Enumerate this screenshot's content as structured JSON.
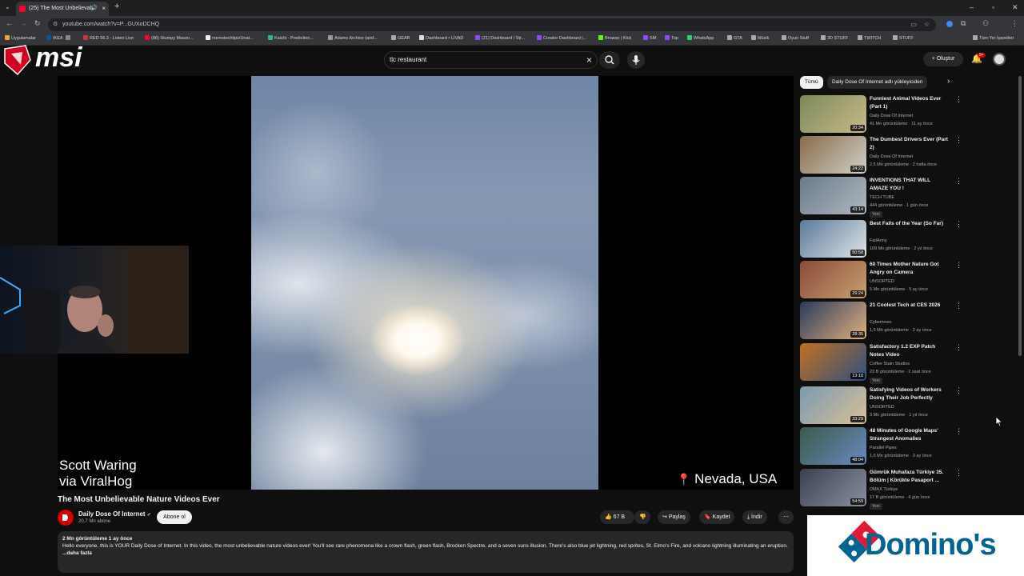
{
  "browser": {
    "tab_title": "(25) The Most Unbelievab",
    "url": "youtube.com/watch?v=P...GUXoDCHQ",
    "bookmarks": [
      "Uygulamalar",
      "IKEA",
      "RED 96.3 - Listen Live",
      "(88) Stumpy Mason...",
      "memstechtips/Unat...",
      "Kaishi - Prediction...",
      "Adams Archive (and...",
      "GEAR",
      "Dashboard • LIVAD",
      "(21) Dashboard / Str...",
      "Creator Dashboard |...",
      "Browse | Kick",
      "SM",
      "Top",
      "WhatsApp",
      "GTA",
      "Müzik",
      "Oyun Stuff",
      "3D STUFF",
      "TWITCH",
      "STUFF"
    ],
    "bookmarks_right": "Tüm Yer İşaretleri"
  },
  "header": {
    "logo_text": "msi",
    "search_value": "tlc restaurant",
    "create_label": "Oluştur",
    "notif_count": "9+"
  },
  "video": {
    "caption_left_1": "Scott Waring",
    "caption_left_2": "via ViralHog",
    "location": "Nevada, USA"
  },
  "info": {
    "title": "The Most Unbelievable Nature Videos Ever",
    "channel": "Daily Dose Of Internet",
    "subscribers": "20,7 Mn abone",
    "subscribe_label": "Abone ol",
    "likes": "67 B",
    "share_label": "Paylaş",
    "save_label": "Kaydet",
    "download_label": "İndir",
    "views_date": "2 Mn görüntüleme  1 ay önce",
    "description": "Hello everyone, this is YOUR Daily Dose of Internet. In this video, the most unbelievable nature videos ever! You'll see rare phenomena like a crown flash, green flash, Brocken Spectre, and a seven suns illusion. There's also blue jet lightning, red sprites, St. Elmo's Fire, and volcano lightning illuminating an eruption.",
    "more_label": "...daha fazla"
  },
  "chips": [
    "Tümü",
    "Daily Dose Of Internet adlı yükleyiciden"
  ],
  "recommendations": [
    {
      "title": "Funniest Animal Videos Ever (Part 1)",
      "channel": "Daily Dose Of Internet",
      "meta": "41 Mn görüntüleme · 11 ay önce",
      "duration": "20:34",
      "badge": ""
    },
    {
      "title": "The Dumbest Drivers Ever (Part 2)",
      "channel": "Daily Dose Of Internet",
      "meta": "2,5 Mn görüntüleme · 2 hafta önce",
      "duration": "24:22",
      "badge": ""
    },
    {
      "title": "INVENTIONS THAT WILL AMAZE YOU !",
      "channel": "TECH TUBE",
      "meta": "444 görüntüleme · 1 gün önce",
      "duration": "43:14",
      "badge": "Yeni"
    },
    {
      "title": "Best Fails of the Year (So Far)",
      "channel": "FailArmy",
      "meta": "109 Mn görüntüleme · 2 yıl önce",
      "duration": "50:58",
      "badge": ""
    },
    {
      "title": "60 Times Mother Nature Got Angry on Camera",
      "channel": "UNSORTED",
      "meta": "5 Mn görüntüleme · 5 ay önce",
      "duration": "29:24",
      "badge": ""
    },
    {
      "title": "21 Coolest Tech at CES 2026",
      "channel": "Cybernews",
      "meta": "1,5 Mn görüntüleme · 2 ay önce",
      "duration": "28:35",
      "badge": ""
    },
    {
      "title": "Satisfactory 1.2 EXP Patch Notes Video",
      "channel": "Coffee Stain Studios",
      "meta": "23 B görüntüleme · 2 saat önce",
      "duration": "13:10",
      "badge": "Yeni"
    },
    {
      "title": "Satisfying Videos of Workers Doing Their Job Perfectly",
      "channel": "UNSORTED",
      "meta": "3 Mn görüntüleme · 1 yıl önce",
      "duration": "33:29",
      "badge": ""
    },
    {
      "title": "48 Minutes of Google Maps' Strangest Anomalies",
      "channel": "Parallel Pipes",
      "meta": "1,6 Mn görüntüleme · 3 ay önce",
      "duration": "48:04",
      "badge": ""
    },
    {
      "title": "Gümrük Muhafaza Türkiye 35. Bölüm | Körükte Pasaport ...",
      "channel": "DMAX Türkiye",
      "meta": "17 B görüntüleme · 4 gün önce",
      "duration": "54:59",
      "badge": "Yeni"
    }
  ],
  "ad": {
    "brand": "Domino's"
  },
  "colors": {
    "youtube_red": "#ff0033",
    "dominos_blue": "#006491",
    "dominos_red": "#e31837",
    "bg": "#0f0f0f"
  }
}
